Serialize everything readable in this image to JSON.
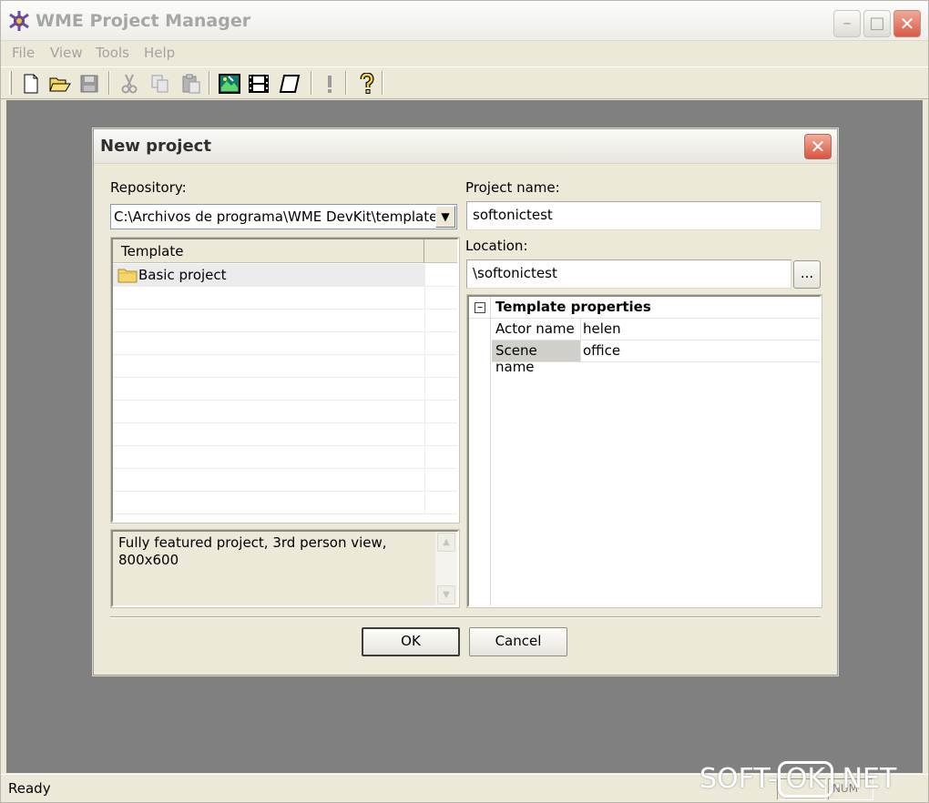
{
  "app": {
    "title": "WME Project Manager",
    "menu": [
      "File",
      "View",
      "Tools",
      "Help"
    ],
    "status": "Ready",
    "status_panel": "NUM",
    "watermark": [
      "SOFT-",
      "OK",
      ".NET"
    ]
  },
  "toolbar": {
    "buttons": [
      "new-icon",
      "open-icon",
      "save-icon",
      "cut-icon",
      "copy-icon",
      "paste-icon",
      "scene-icon",
      "film-icon",
      "script-icon",
      "exclamation-icon",
      "help-icon"
    ]
  },
  "dialog": {
    "title": "New project",
    "repository_label": "Repository:",
    "repository_value": "C:\\Archivos de programa\\WME DevKit\\template\\",
    "template_header": "Template",
    "templates": [
      "Basic project"
    ],
    "description": "Fully featured project, 3rd person view, 800x600",
    "project_name_label": "Project name:",
    "project_name_value": "softonictest",
    "location_label": "Location:",
    "location_value": "\\softonictest",
    "browse_label": "...",
    "properties": {
      "category": "Template properties",
      "rows": [
        {
          "name": "Actor name",
          "value": "helen"
        },
        {
          "name": "Scene name",
          "value": "office"
        }
      ]
    },
    "ok_label": "OK",
    "cancel_label": "Cancel"
  },
  "colors": {
    "window_bg": "#ece9d8",
    "workspace_bg": "#808080",
    "close_red": "#d9543e"
  }
}
